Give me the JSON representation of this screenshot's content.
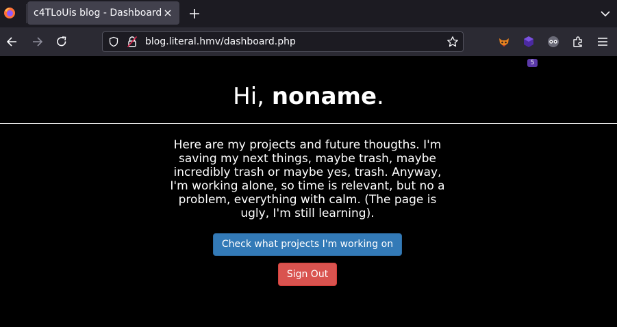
{
  "browser": {
    "tab_title": "c4TLoUis blog - Dashboard",
    "url": "blog.literal.hmv/dashboard.php",
    "extension_badge": "5"
  },
  "page": {
    "greeting_prefix": "Hi, ",
    "username": "noname",
    "greeting_suffix": ".",
    "intro": "Here are my projects and future thougths. I'm saving my next things, maybe trash, maybe incredibly trash or maybe yes, trash. Anyway, I'm working alone, so time is relevant, but no a problem, everything with calm. (The page is ugly, I'm still learning).",
    "projects_button": "Check what projects I'm working on",
    "signout_button": "Sign Out"
  },
  "colors": {
    "page_bg": "#000000",
    "primary_button": "#337ab7",
    "danger_button": "#d9534f"
  },
  "icons": [
    "firefox-logo-icon",
    "close-icon",
    "plus-icon",
    "chevron-down-icon",
    "back-arrow-icon",
    "forward-arrow-icon",
    "reload-icon",
    "shield-icon",
    "insecure-lock-icon",
    "star-icon",
    "extension-fox-icon",
    "extension-hex-icon",
    "extension-mask-icon",
    "puzzle-icon",
    "hamburger-menu-icon"
  ]
}
